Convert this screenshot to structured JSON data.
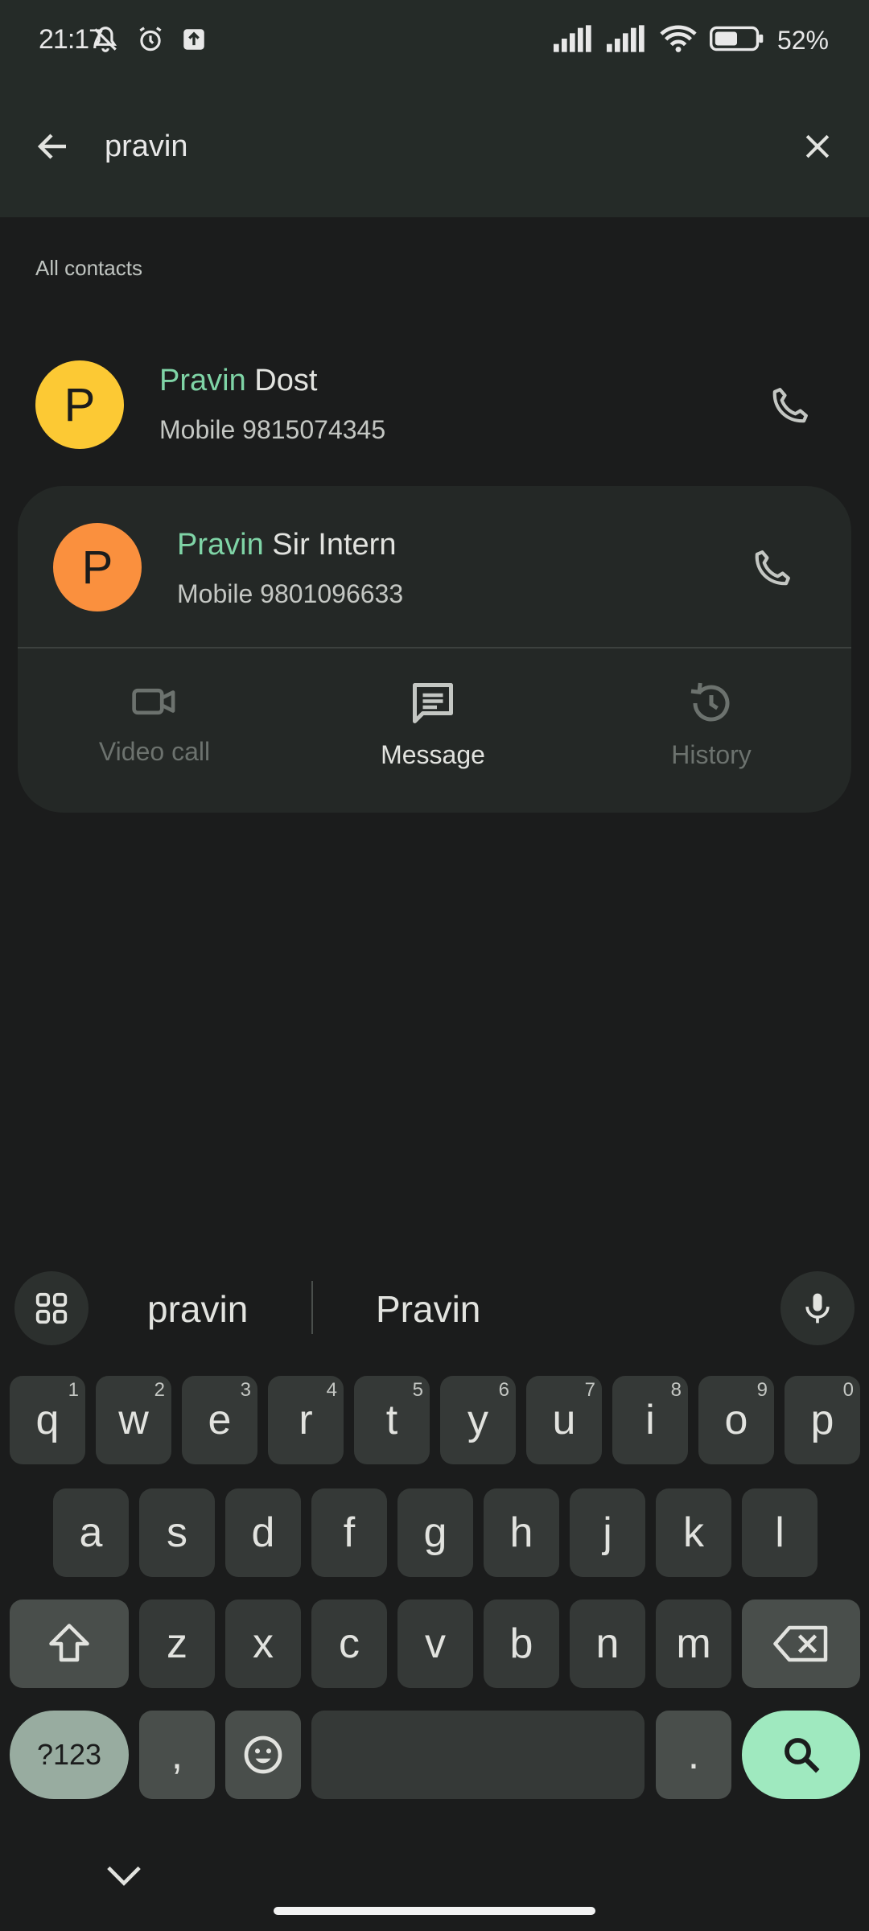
{
  "status_bar": {
    "time": "21:17",
    "battery": "52"
  },
  "search": {
    "value": "pravin",
    "placeholder": ""
  },
  "section_label": "All contacts",
  "contacts": [
    {
      "initial": "P",
      "name_match": "Pravin",
      "name_rest": " Dost",
      "detail": "Mobile 9815074345",
      "avatar_color": "#fcc934"
    },
    {
      "initial": "P",
      "name_match": "Pravin",
      "name_rest": " Sir Intern",
      "detail": "Mobile 9801096633",
      "avatar_color": "#fa903e"
    }
  ],
  "actions": [
    {
      "label": "Video call",
      "icon": "video-icon",
      "enabled": false
    },
    {
      "label": "Message",
      "icon": "message-icon",
      "enabled": true
    },
    {
      "label": "History",
      "icon": "history-icon",
      "enabled": false
    }
  ],
  "keyboard": {
    "suggestions": [
      "pravin",
      "Pravin"
    ],
    "row1": [
      [
        "q",
        "1"
      ],
      [
        "w",
        "2"
      ],
      [
        "e",
        "3"
      ],
      [
        "r",
        "4"
      ],
      [
        "t",
        "5"
      ],
      [
        "y",
        "6"
      ],
      [
        "u",
        "7"
      ],
      [
        "i",
        "8"
      ],
      [
        "o",
        "9"
      ],
      [
        "p",
        "0"
      ]
    ],
    "row2": [
      "a",
      "s",
      "d",
      "f",
      "g",
      "h",
      "j",
      "k",
      "l"
    ],
    "row3": [
      "z",
      "x",
      "c",
      "v",
      "b",
      "n",
      "m"
    ],
    "symbols_label": "?123",
    "comma": ",",
    "period": "."
  },
  "colors": {
    "highlight": "#7fd4a6",
    "search_key": "#9fe9bf",
    "symbols_key": "#98aca0"
  }
}
